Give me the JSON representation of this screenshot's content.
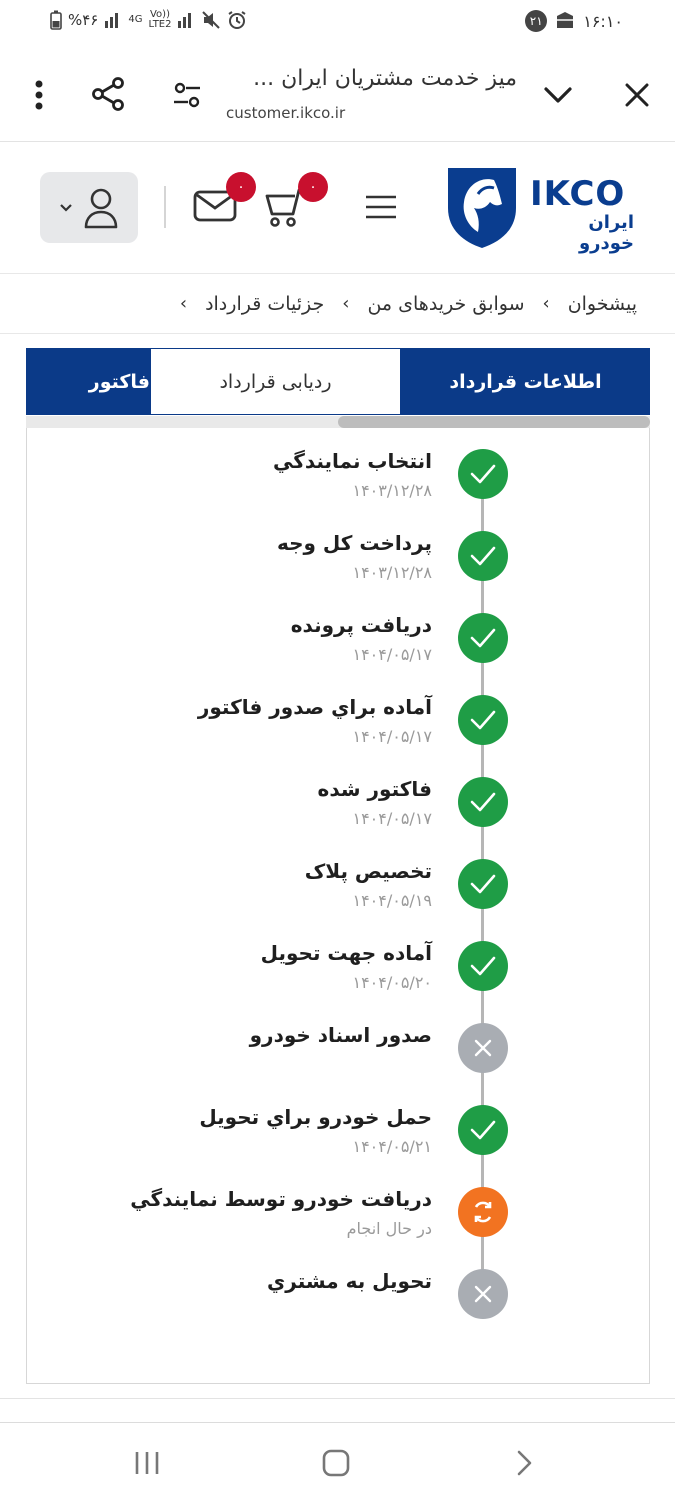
{
  "status_bar": {
    "time": "۱۶:۱۰",
    "notification_count": "۲۱",
    "battery": "%۴۶",
    "net_4g": "4G",
    "net_volte": "Vo))",
    "net_lte": "LTE2"
  },
  "browser": {
    "title": "میز خدمت مشتریان ایران ...",
    "url": "customer.ikco.ir"
  },
  "header": {
    "cart_count": "۰",
    "mail_count": "۰",
    "logo_text": "IKCO",
    "logo_subtext": "ایران خودرو"
  },
  "breadcrumb": {
    "items": [
      "پیشخوان",
      "سوابق خریدهای من",
      "جزئیات قرارداد"
    ]
  },
  "tabs": {
    "contract_info": "اطلاعات قرارداد",
    "contract_tracking": "ردیابی قرارداد",
    "invoice": "فاکتور"
  },
  "timeline": {
    "steps": [
      {
        "title": "انتخاب نمايندگي",
        "sub": "۱۴۰۳/۱۲/۲۸",
        "status": "done"
      },
      {
        "title": "پرداخت كل وجه",
        "sub": "۱۴۰۳/۱۲/۲۸",
        "status": "done"
      },
      {
        "title": "دريافت پرونده",
        "sub": "۱۴۰۴/۰۵/۱۷",
        "status": "done"
      },
      {
        "title": "آماده براي صدور فاكتور",
        "sub": "۱۴۰۴/۰۵/۱۷",
        "status": "done"
      },
      {
        "title": "فاكتور شده",
        "sub": "۱۴۰۴/۰۵/۱۷",
        "status": "done"
      },
      {
        "title": "تخصيص پلاک",
        "sub": "۱۴۰۴/۰۵/۱۹",
        "status": "done"
      },
      {
        "title": "آماده جهت تحويل",
        "sub": "۱۴۰۴/۰۵/۲۰",
        "status": "done"
      },
      {
        "title": "صدور اسناد خودرو",
        "sub": "",
        "status": "cancel"
      },
      {
        "title": "حمل خودرو براي تحويل",
        "sub": "۱۴۰۴/۰۵/۲۱",
        "status": "done"
      },
      {
        "title": "دريافت خودرو توسط نمايندگي",
        "sub": "در حال انجام",
        "status": "progress"
      },
      {
        "title": "تحويل به مشتري",
        "sub": "",
        "status": "cancel"
      }
    ]
  },
  "colors": {
    "primary": "#0b3a88",
    "done": "#1f9d46",
    "cancel": "#a9adb3",
    "progress": "#f27321",
    "badge": "#c8102e"
  }
}
